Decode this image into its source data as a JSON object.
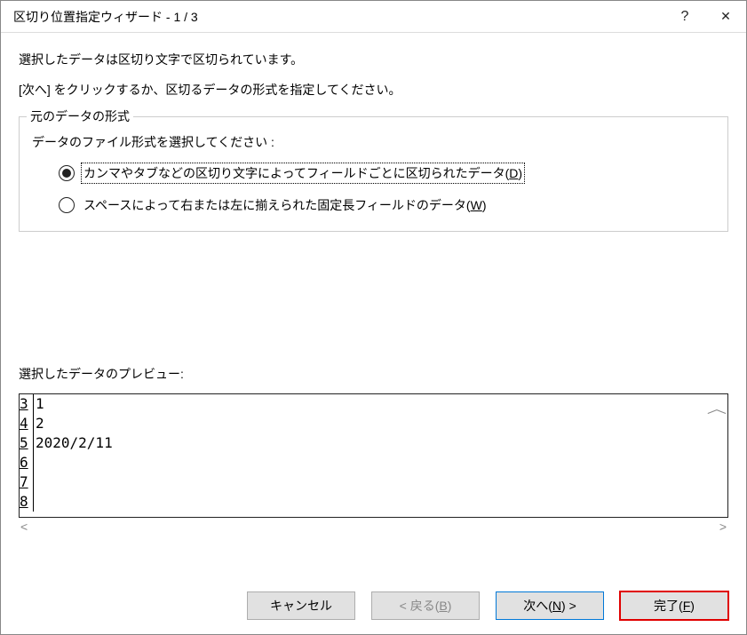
{
  "titlebar": {
    "title": "区切り位置指定ウィザード - 1 / 3",
    "help": "?",
    "close": "✕"
  },
  "intro": {
    "line1": "選択したデータは区切り文字で区切られています。",
    "line2": "[次へ] をクリックするか、区切るデータの形式を指定してください。"
  },
  "fieldset": {
    "legend": "元のデータの形式",
    "prompt": "データのファイル形式を選択してください :",
    "opt1_pre": "カンマやタブなどの区切り文字によってフィールドごとに区切られたデータ(",
    "opt1_key": "D",
    "opt1_post": ")",
    "opt2_pre": "スペースによって右または左に揃えられた固定長フィールドのデータ(",
    "opt2_key": "W",
    "opt2_post": ")"
  },
  "preview": {
    "label": "選択したデータのプレビュー:",
    "rows": [
      {
        "n": "3",
        "v": "1"
      },
      {
        "n": "4",
        "v": "2"
      },
      {
        "n": "5",
        "v": "2020/2/11"
      },
      {
        "n": "6",
        "v": ""
      },
      {
        "n": "7",
        "v": ""
      },
      {
        "n": "8",
        "v": ""
      }
    ]
  },
  "buttons": {
    "cancel": "キャンセル",
    "back_pre": "< 戻る(",
    "back_key": "B",
    "back_post": ")",
    "next_pre": "次へ(",
    "next_key": "N",
    "next_post": ") >",
    "finish_pre": "完了(",
    "finish_key": "F",
    "finish_post": ")"
  }
}
